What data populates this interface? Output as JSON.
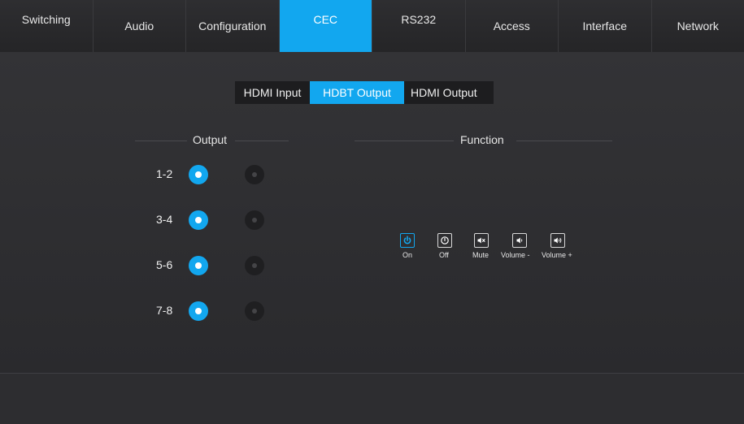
{
  "nav": {
    "tabs": [
      {
        "label": "Switching"
      },
      {
        "label": "Audio"
      },
      {
        "label": "Configuration"
      },
      {
        "label": "CEC"
      },
      {
        "label": "RS232"
      },
      {
        "label": "Access"
      },
      {
        "label": "Interface"
      },
      {
        "label": "Network"
      }
    ],
    "active": "CEC"
  },
  "subtabs": {
    "items": [
      {
        "label": "HDMI Input"
      },
      {
        "label": "HDBT Output"
      },
      {
        "label": "HDMI Output"
      }
    ],
    "active": "HDBT Output"
  },
  "output": {
    "title": "Output",
    "rows": [
      {
        "label": "1-2",
        "selected": true
      },
      {
        "label": "3-4",
        "selected": true
      },
      {
        "label": "5-6",
        "selected": true
      },
      {
        "label": "7-8",
        "selected": true
      }
    ]
  },
  "function": {
    "title": "Function",
    "buttons": [
      {
        "label": "On",
        "icon": "power-icon",
        "active": true
      },
      {
        "label": "Off",
        "icon": "power-off-icon",
        "active": false
      },
      {
        "label": "Mute",
        "icon": "mute-icon",
        "active": false
      },
      {
        "label": "Volume -",
        "icon": "volume-down-icon",
        "active": false
      },
      {
        "label": "Volume +",
        "icon": "volume-up-icon",
        "active": false
      }
    ]
  },
  "colors": {
    "accent": "#12a7ef",
    "background": "#2b2b2e"
  }
}
